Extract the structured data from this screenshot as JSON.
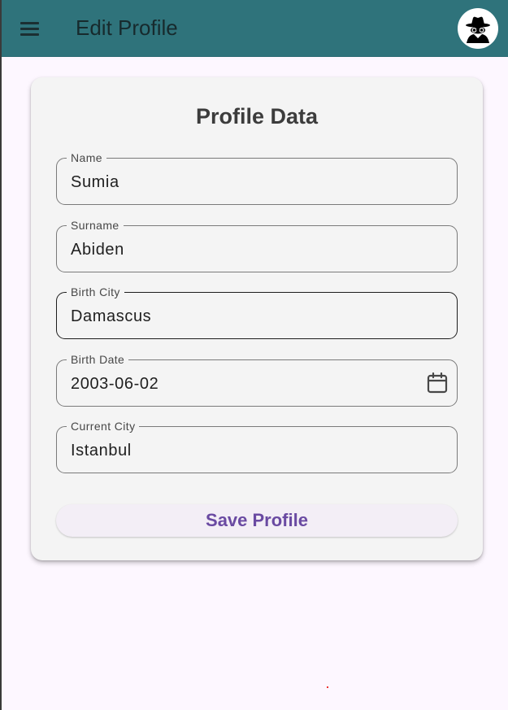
{
  "appbar": {
    "title": "Edit Profile",
    "menu_icon": "menu-icon",
    "avatar_icon": "incognito-spy-icon",
    "background_color": "#2f737b"
  },
  "card": {
    "title": "Profile Data",
    "fields": [
      {
        "label": "Name",
        "value": "Sumia"
      },
      {
        "label": "Surname",
        "value": "Abiden"
      },
      {
        "label": "Birth City",
        "value": "Damascus",
        "focused": true
      },
      {
        "label": "Birth Date",
        "value": "2003-06-02",
        "icon": "calendar-icon"
      },
      {
        "label": "Current City",
        "value": "Istanbul"
      }
    ],
    "save_label": "Save Profile",
    "accent_color": "#6a4aa2"
  }
}
